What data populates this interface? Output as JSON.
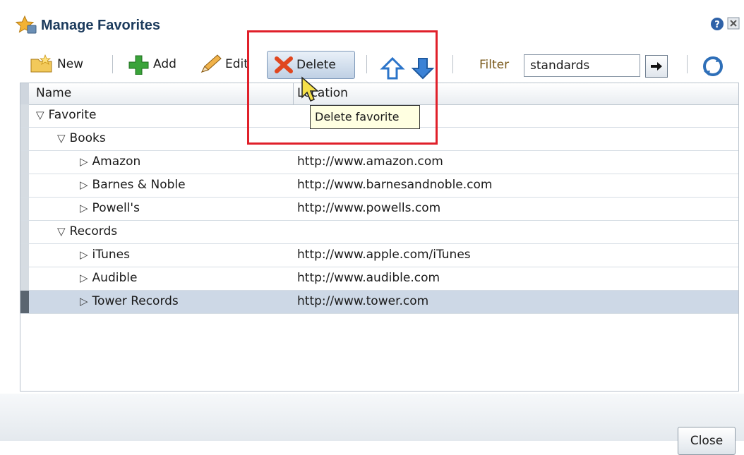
{
  "dialog": {
    "title": "Manage Favorites"
  },
  "toolbar": {
    "new_label": "New",
    "add_label": "Add",
    "edit_label": "Edit",
    "delete_label": "Delete",
    "filter_label": "Filter",
    "filter_value": "standards"
  },
  "table": {
    "columns": [
      "Name",
      "Location"
    ],
    "rows": [
      {
        "name": "Favorite",
        "location": "",
        "level": 0,
        "expand": "expanded"
      },
      {
        "name": "Books",
        "location": "",
        "level": 1,
        "expand": "expanded"
      },
      {
        "name": "Amazon",
        "location": "http://www.amazon.com",
        "level": 2,
        "expand": "collapsed"
      },
      {
        "name": "Barnes & Noble",
        "location": "http://www.barnesandnoble.com",
        "level": 2,
        "expand": "collapsed"
      },
      {
        "name": "Powell's",
        "location": "http://www.powells.com",
        "level": 2,
        "expand": "collapsed"
      },
      {
        "name": "Records",
        "location": "",
        "level": 1,
        "expand": "expanded"
      },
      {
        "name": "iTunes",
        "location": "http://www.apple.com/iTunes",
        "level": 2,
        "expand": "collapsed"
      },
      {
        "name": "Audible",
        "location": "http://www.audible.com",
        "level": 2,
        "expand": "collapsed"
      },
      {
        "name": "Tower Records",
        "location": "http://www.tower.com",
        "level": 2,
        "expand": "collapsed",
        "selected": true
      }
    ]
  },
  "tooltip": {
    "text": "Delete favorite"
  },
  "footer": {
    "close_label": "Close"
  },
  "colors": {
    "highlight": "#e0202a",
    "selection": "#cdd8e6",
    "title": "#1b3a5c"
  }
}
